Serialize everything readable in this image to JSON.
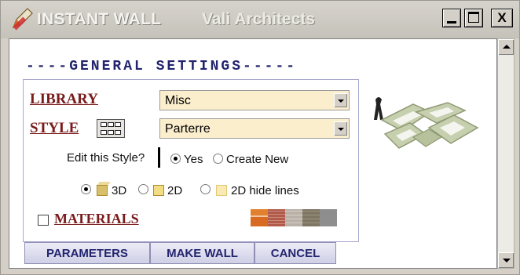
{
  "window": {
    "title": "INSTANT WALL",
    "subtitle": "Vali Architects",
    "controls": {
      "minimize": "_",
      "maximize": "□",
      "close": "X"
    }
  },
  "settings": {
    "heading": "----GENERAL SETTINGS-----",
    "library_label": "LIBRARY",
    "library_value": "Misc",
    "style_label": "STYLE",
    "style_value": "Parterre",
    "edit_style_label": "Edit this Style?",
    "edit_options": {
      "yes": "Yes",
      "create_new": "Create New",
      "selected": "yes"
    },
    "view_options": {
      "opt_3d": "3D",
      "opt_2d": "2D",
      "opt_2d_hide": "2D hide lines",
      "selected": "3D"
    },
    "materials_label": "MATERIALS",
    "materials_checked": false,
    "material_swatches": [
      "#d9722b",
      "#b25b4b",
      "#b9b0a7",
      "#7f7563",
      "#8e8e8e"
    ]
  },
  "buttons": {
    "parameters": "PARAMETERS",
    "make_wall": "MAKE WALL",
    "cancel": "CANCEL"
  },
  "icons": {
    "app": "pencil-ruler-icon",
    "style_grid": "grid-icon",
    "preview": "wall-preview-image"
  },
  "colors": {
    "label_red": "#7a1b1b",
    "heading_navy": "#23246e",
    "select_bg": "#fbeecd"
  }
}
